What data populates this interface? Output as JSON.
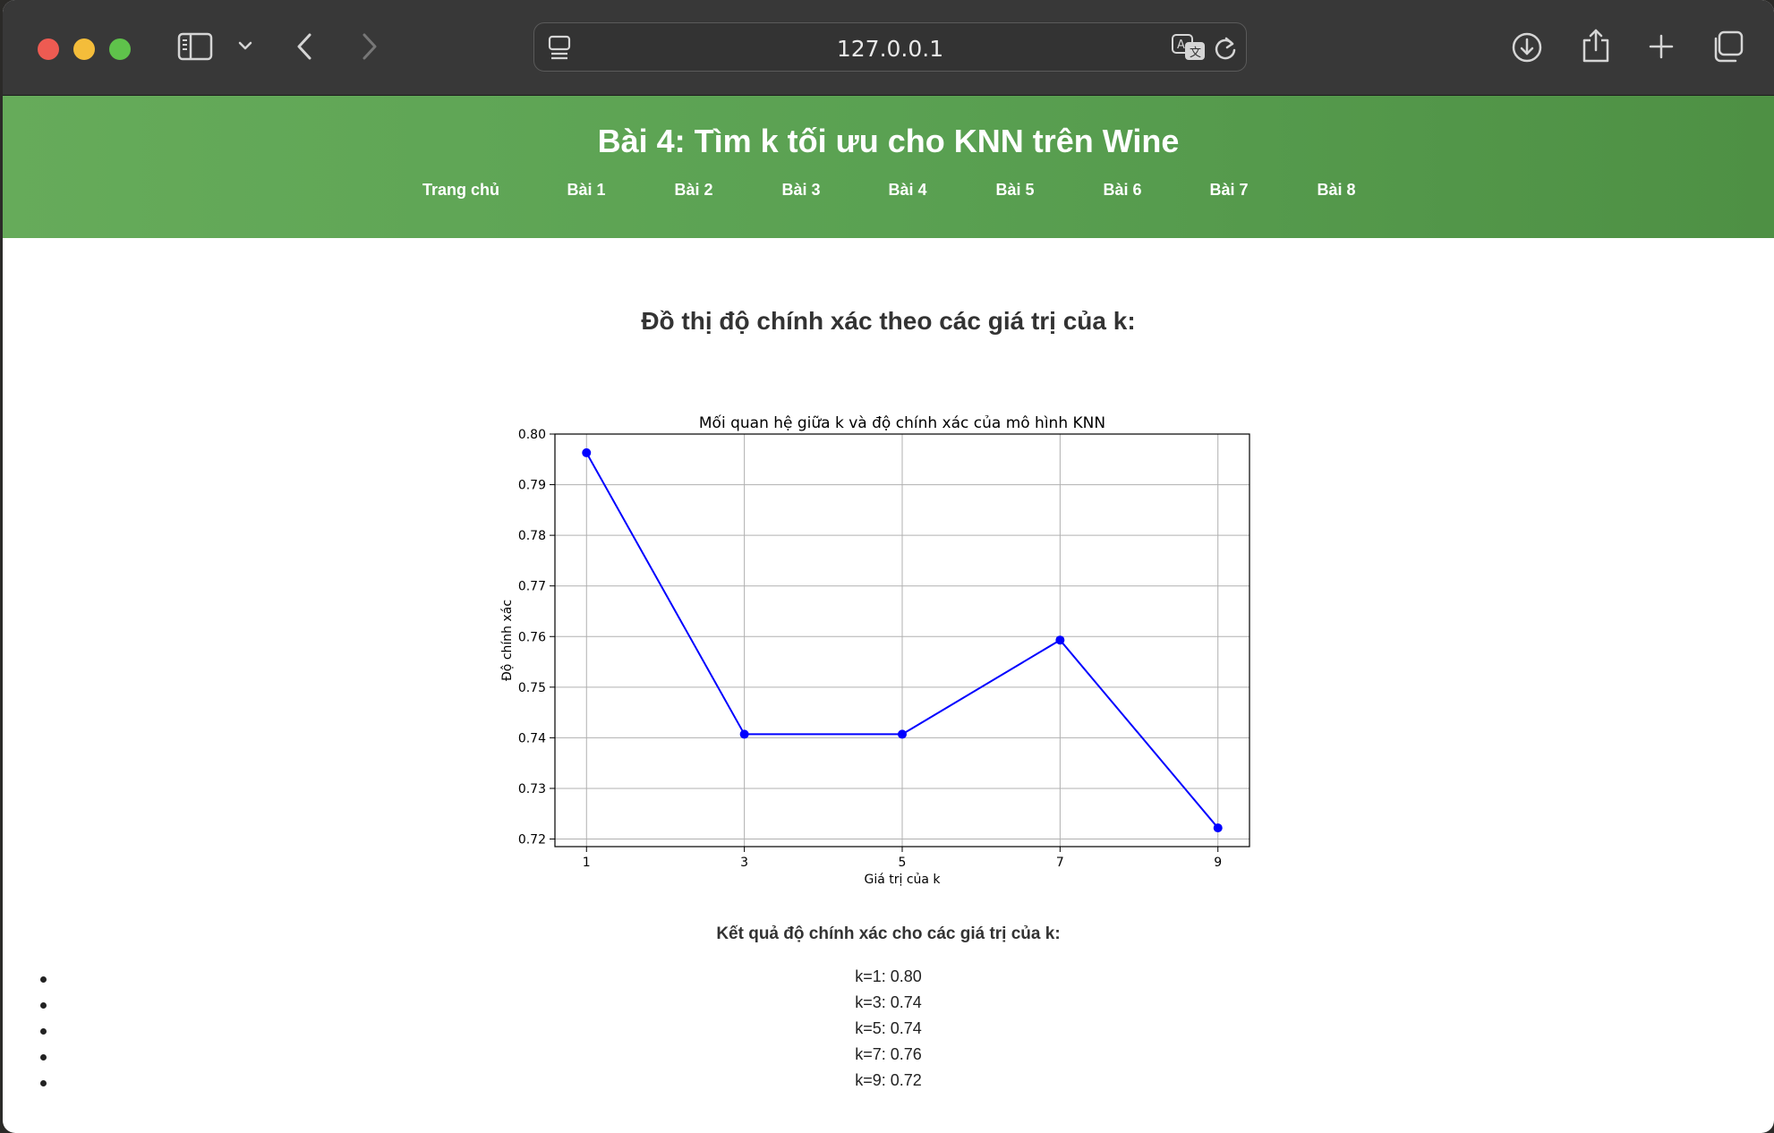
{
  "browser": {
    "url": "127.0.0.1",
    "colors": {
      "close": "#ee5b52",
      "minimize": "#f4bd3a",
      "zoom": "#5fc24b"
    }
  },
  "header": {
    "title": "Bài 4: Tìm k tối ưu cho KNN trên Wine",
    "nav": [
      "Trang chủ",
      "Bài 1",
      "Bài 2",
      "Bài 3",
      "Bài 4",
      "Bài 5",
      "Bài 6",
      "Bài 7",
      "Bài 8"
    ],
    "color": "#5aa152"
  },
  "main": {
    "section_heading": "Đồ thị độ chính xác theo các giá trị của k:",
    "results_heading": "Kết quả độ chính xác cho các giá trị của k:",
    "results": [
      "k=1: 0.80",
      "k=3: 0.74",
      "k=5: 0.74",
      "k=7: 0.76",
      "k=9: 0.72"
    ]
  },
  "chart_data": {
    "type": "line",
    "title": "Mối quan hệ giữa k và độ chính xác của mô hình KNN",
    "xlabel": "Giá trị của k",
    "ylabel": "Độ chính xác",
    "x": [
      1,
      3,
      5,
      7,
      9
    ],
    "series": [
      {
        "values": [
          0.7963,
          0.7407,
          0.7407,
          0.7593,
          0.7222
        ],
        "color": "#0000ff",
        "marker": "circle"
      }
    ],
    "xticks": [
      "1",
      "3",
      "5",
      "7",
      "9"
    ],
    "yticks": [
      "0.72",
      "0.73",
      "0.74",
      "0.75",
      "0.76",
      "0.77",
      "0.78",
      "0.79",
      "0.80"
    ],
    "ylim": [
      0.7185,
      0.8
    ],
    "xlim": [
      0.6,
      9.4
    ],
    "grid": true
  }
}
